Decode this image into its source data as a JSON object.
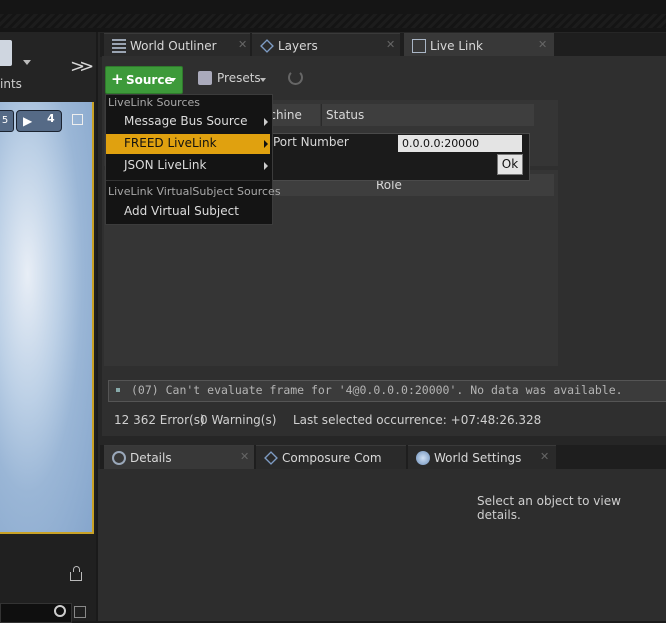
{
  "left_panel": {
    "blueprints_label": "ints",
    "viewport_buttons": {
      "camera_speed": "4"
    }
  },
  "top_tabs": [
    {
      "label": "World Outliner",
      "icon": "list-icon"
    },
    {
      "label": "Layers",
      "icon": "layers-icon"
    },
    {
      "label": "Live Link",
      "icon": "livelink-icon",
      "active": true
    }
  ],
  "toolbar": {
    "source_label": "Source",
    "presets_label": "Presets"
  },
  "sources_table": {
    "columns": [
      "achine",
      "Status"
    ]
  },
  "subjects_table": {
    "columns": [
      "Role"
    ]
  },
  "source_menu": {
    "section1": "LiveLink Sources",
    "items": [
      "Message Bus Source",
      "FREED LiveLink",
      "JSON LiveLink"
    ],
    "highlighted": "FREED LiveLink",
    "section2": "LiveLink VirtualSubject Sources",
    "virtual_items": [
      "Add Virtual Subject"
    ]
  },
  "freed_popup": {
    "port_label": "Port Number",
    "port_value": "0.0.0.0:20000",
    "ok_label": "Ok"
  },
  "log": {
    "message": "(07) Can't evaluate frame for '4@0.0.0.0:20000'. No data was available.",
    "errors": "12 362 Error(s)",
    "warnings": "0 Warning(s)",
    "last_occurrence": "Last selected occurrence: +07:48:26.328"
  },
  "bottom_tabs": [
    {
      "label": "Details",
      "icon": "details-icon",
      "active": true
    },
    {
      "label": "Composure Compo",
      "icon": "layers-icon"
    },
    {
      "label": "World Settings",
      "icon": "globe-icon"
    }
  ],
  "details": {
    "empty_message": "Select an object to view details."
  },
  "colors": {
    "accent_green": "#3d9a3a",
    "menu_highlight": "#e0a10f",
    "viewport_border": "#c9a227"
  }
}
